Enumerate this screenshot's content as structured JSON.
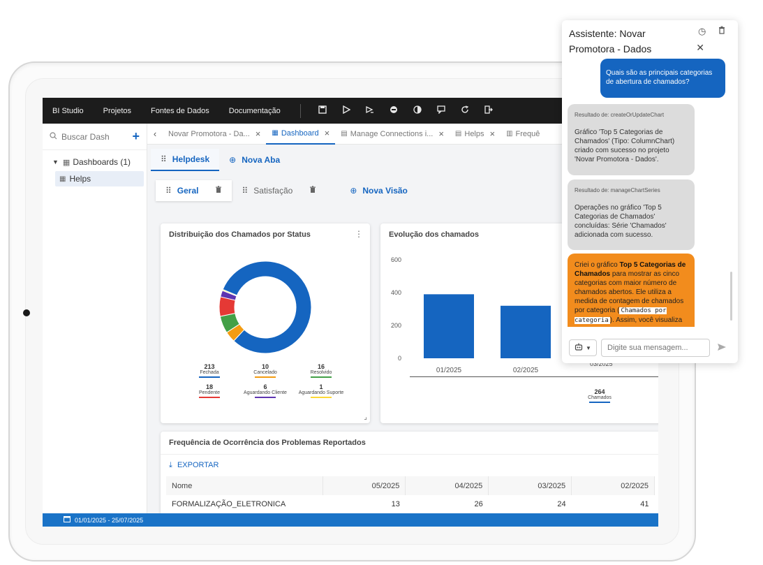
{
  "topbar": {
    "menus": [
      "BI Studio",
      "Projetos",
      "Fontes de Dados",
      "Documentação"
    ],
    "icons": [
      "save-icon",
      "play-icon",
      "run-selected-icon",
      "stop-icon",
      "contrast-icon",
      "comment-icon",
      "refresh-icon",
      "exit-icon"
    ]
  },
  "sidebar": {
    "search_placeholder": "Buscar Dash",
    "root_label": "Dashboards (1)",
    "items": [
      "Helps"
    ]
  },
  "tabs": [
    {
      "label": "Novar Promotora - Da...",
      "active": false
    },
    {
      "label": "Dashboard",
      "active": true
    },
    {
      "label": "Manage Connections i...",
      "active": false
    },
    {
      "label": "Helps",
      "active": false
    },
    {
      "label": "Frequê",
      "active": false
    }
  ],
  "page_tabs": {
    "current": "Helpdesk",
    "add": "Nova Aba"
  },
  "view_tabs": {
    "first": "Geral",
    "second": "Satisfação",
    "add": "Nova Visão"
  },
  "status_card": {
    "title": "Distribuição dos Chamados por Status",
    "legend": [
      {
        "value": "213",
        "label": "Fechada",
        "color": "#1565c0"
      },
      {
        "value": "10",
        "label": "Cancelado",
        "color": "#f39c12"
      },
      {
        "value": "16",
        "label": "Resolvido",
        "color": "#43a047"
      },
      {
        "value": "18",
        "label": "Pendente",
        "color": "#e53935"
      },
      {
        "value": "6",
        "label": "Aguardando Cliente",
        "color": "#5e35b1"
      },
      {
        "value": "1",
        "label": "Aguardando Suporte",
        "color": "#fdd835"
      }
    ]
  },
  "evolution_card": {
    "title": "Evolução dos chamados",
    "legend_value": "264",
    "legend_label": "Chamados",
    "partial_label": "03/2025"
  },
  "chart_data": [
    {
      "type": "pie",
      "title": "Distribuição dos Chamados por Status",
      "donut": true,
      "categories": [
        "Fechada",
        "Cancelado",
        "Resolvido",
        "Pendente",
        "Aguardando Cliente",
        "Aguardando Suporte"
      ],
      "values": [
        213,
        10,
        16,
        18,
        6,
        1
      ],
      "colors": [
        "#1565c0",
        "#f39c12",
        "#43a047",
        "#e53935",
        "#5e35b1",
        "#fdd835"
      ]
    },
    {
      "type": "bar",
      "title": "Evolução dos chamados",
      "categories": [
        "01/2025",
        "02/2025"
      ],
      "series": [
        {
          "name": "Chamados",
          "values": [
            390,
            320
          ]
        }
      ],
      "ylim": [
        0,
        600
      ],
      "yticks": [
        0,
        200,
        400,
        600
      ],
      "color": "#1565c0"
    }
  ],
  "freq_card": {
    "title": "Frequência de Ocorrência dos Problemas Reportados",
    "export_label": "EXPORTAR",
    "columns": [
      "Nome",
      "05/2025",
      "04/2025",
      "03/2025",
      "02/2025"
    ],
    "rows": [
      [
        "FORMALIZAÇÃO_ELETRONICA",
        "13",
        "26",
        "24",
        "41"
      ]
    ]
  },
  "statusbar": {
    "date_range": "01/01/2025 - 25/07/2025"
  },
  "chat": {
    "title": "Assistente: Novar Promotora - Dados",
    "user_message": "Quais são as principais categorias de abertura de chamados?",
    "results": [
      {
        "label": "Resultado de: createOrUpdateChart",
        "text": "Gráfico 'Top 5 Categorias de Chamados' (Tipo: ColumnChart) criado com sucesso no projeto 'Novar Promotora - Dados'."
      },
      {
        "label": "Resultado de: manageChartSeries",
        "text": "Operações no gráfico 'Top 5 Categorias de Chamados' concluídas: Série 'Chamados' adicionada com sucesso."
      }
    ],
    "ai_prefix": "Criei o gráfico ",
    "ai_bold": "Top 5 Categorias de Chamados",
    "ai_middle": " para mostrar as cinco categorias com maior número de chamados abertos. Ele utiliza a medida de contagem de chamados por categoria (",
    "ai_code": "Chamados por categoria",
    "ai_suffix": "). Assim, você visualiza",
    "input_placeholder": "Digite sua mensagem..."
  }
}
